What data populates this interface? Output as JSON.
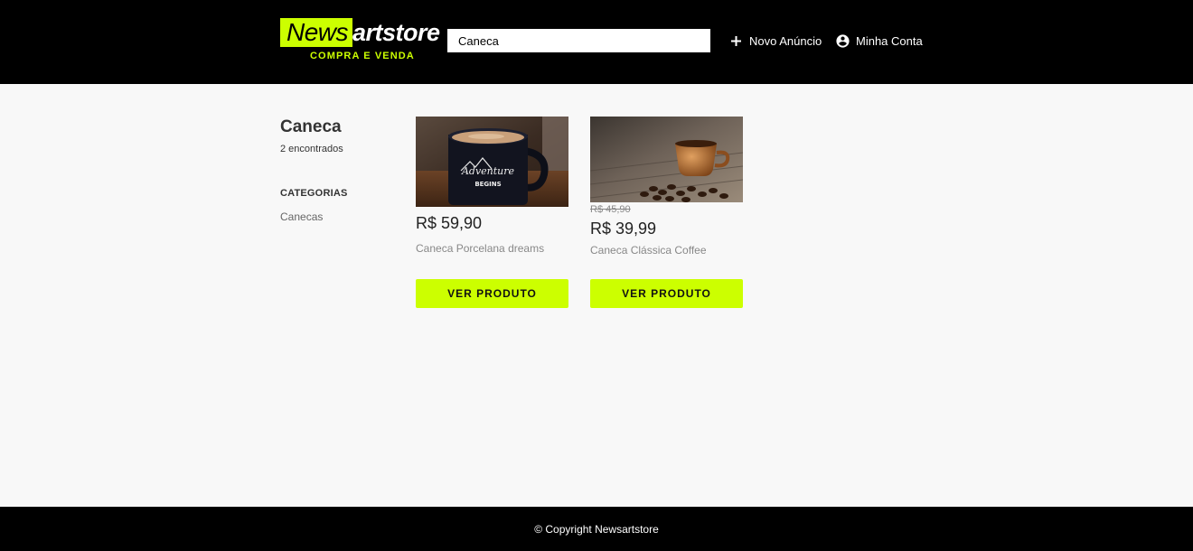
{
  "brand": {
    "name_highlight": "News",
    "name_rest": "artstore",
    "tagline": "COMPRA E VENDA",
    "accent_color": "#ccff00"
  },
  "search": {
    "value": "Caneca",
    "placeholder": ""
  },
  "nav": {
    "new_listing": {
      "label": "Novo Anúncio",
      "icon": "plus-icon"
    },
    "account": {
      "label": "Minha Conta",
      "icon": "account-circle-icon"
    }
  },
  "results": {
    "title": "Caneca",
    "count": "2 encontrados"
  },
  "categories": {
    "heading": "CATEGORIAS",
    "items": [
      "Canecas"
    ]
  },
  "products": [
    {
      "image": "black-enamel-mug-photo",
      "old_price": "",
      "price": "R$ 59,90",
      "name": "Caneca Porcelana dreams",
      "button": "VER PRODUTO"
    },
    {
      "image": "copper-espresso-cup-photo",
      "old_price": "R$ 45,90",
      "price": "R$ 39,99",
      "name": "Caneca Clássica Coffee",
      "button": "VER PRODUTO"
    }
  ],
  "footer": {
    "copyright": "© Copyright Newsartstore"
  }
}
